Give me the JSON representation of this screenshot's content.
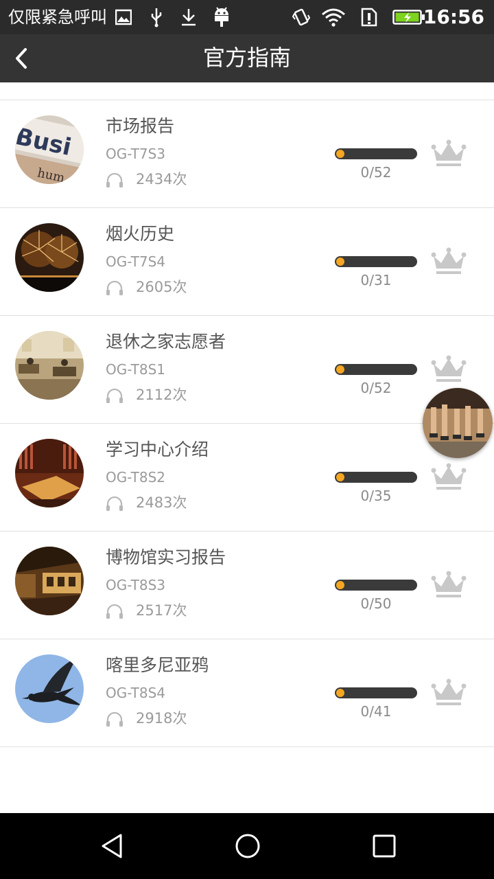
{
  "status_bar": {
    "carrier": "仅限紧急呼叫",
    "time": "16:56",
    "icons": [
      "image-icon",
      "usb-icon",
      "download-icon",
      "android-icon",
      "vibrate-icon",
      "wifi-icon",
      "sim-alert-icon",
      "battery-charging-icon"
    ]
  },
  "header": {
    "title": "官方指南",
    "back_icon": "chevron-left-icon"
  },
  "items": [
    {
      "name": "市场报告",
      "code": "OG-T7S3",
      "plays": "2434次",
      "progress_text": "0/52",
      "progress": 0
    },
    {
      "name": "烟火历史",
      "code": "OG-T7S4",
      "plays": "2605次",
      "progress_text": "0/31",
      "progress": 0
    },
    {
      "name": "退休之家志愿者",
      "code": "OG-T8S1",
      "plays": "2112次",
      "progress_text": "0/52",
      "progress": 0
    },
    {
      "name": "学习中心介绍",
      "code": "OG-T8S2",
      "plays": "2483次",
      "progress_text": "0/35",
      "progress": 0
    },
    {
      "name": "博物馆实习报告",
      "code": "OG-T8S3",
      "plays": "2517次",
      "progress_text": "0/50",
      "progress": 0
    },
    {
      "name": "喀里多尼亚鸦",
      "code": "OG-T8S4",
      "plays": "2918次",
      "progress_text": "0/41",
      "progress": 0
    }
  ],
  "colors": {
    "accent": "#f5a623",
    "header_bg": "#343434",
    "crown": "#c8c8c8"
  },
  "nav_bar": {
    "icons": [
      "back-triangle-icon",
      "home-circle-icon",
      "recents-square-icon"
    ]
  }
}
